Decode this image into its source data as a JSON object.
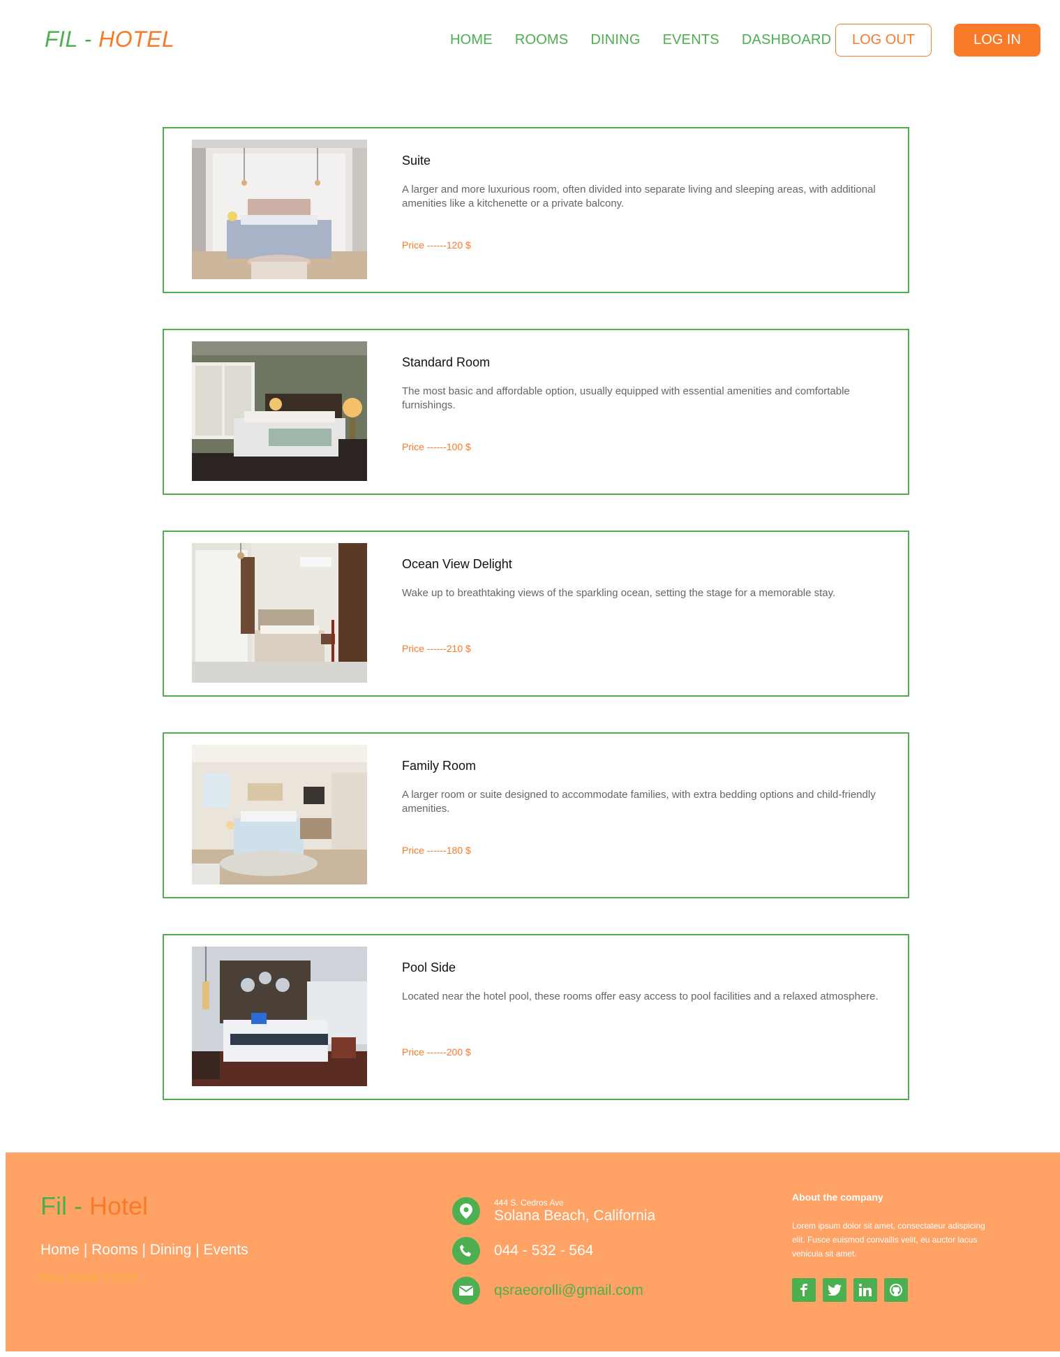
{
  "header": {
    "logo_part1": "FIL -",
    "logo_part2": "HOTEL",
    "nav": [
      "HOME",
      "ROOMS",
      "DINING",
      "EVENTS",
      "DASHBOARD"
    ],
    "logout_label": "LOG OUT",
    "login_label": "LOG IN"
  },
  "rooms": [
    {
      "title": "Suite",
      "description": "A larger and more luxurious room, often divided into separate living and sleeping areas, with additional amenities like a kitchenette or a private balcony.",
      "price": "Price ------120 $"
    },
    {
      "title": "Standard Room",
      "description": "The most basic and affordable option, usually equipped with essential amenities and comfortable furnishings.",
      "price": "Price ------100 $"
    },
    {
      "title": "Ocean View Delight",
      "description": "Wake up to breathtaking views of the sparkling ocean, setting the stage for a memorable stay.",
      "price": "Price ------210 $"
    },
    {
      "title": "Family Room",
      "description": "A larger room or suite designed to accommodate families, with extra bedding options and child-friendly amenities.",
      "price": "Price ------180 $"
    },
    {
      "title": "Pool Side",
      "description": "Located near the hotel pool, these rooms offer easy access to pool facilities and a relaxed atmosphere.",
      "price": "Price ------200 $"
    }
  ],
  "footer": {
    "logo_part1": "Fil -",
    "logo_part2": "Hotel",
    "links": "Home | Rooms | Dining | Events",
    "copyright": "Esra Corolli © 2023",
    "address_line1": "444 S. Cedros Ave",
    "address_line2": "Solana Beach, California",
    "phone": "044 - 532 - 564",
    "email": "qsraeorolli@gmail.com",
    "about_title": "About the company",
    "about_text": "Lorem ipsum dolor sit amet, consectateur adispicing elit. Fusce euismod convallis velit, eu auctor lacus vehicula sit amet.",
    "social_icons": [
      "facebook-icon",
      "twitter-icon",
      "linkedin-icon",
      "github-icon"
    ]
  },
  "colors": {
    "green": "#4caf50",
    "orange": "#f97a28",
    "footer_bg": "#ffa265"
  }
}
